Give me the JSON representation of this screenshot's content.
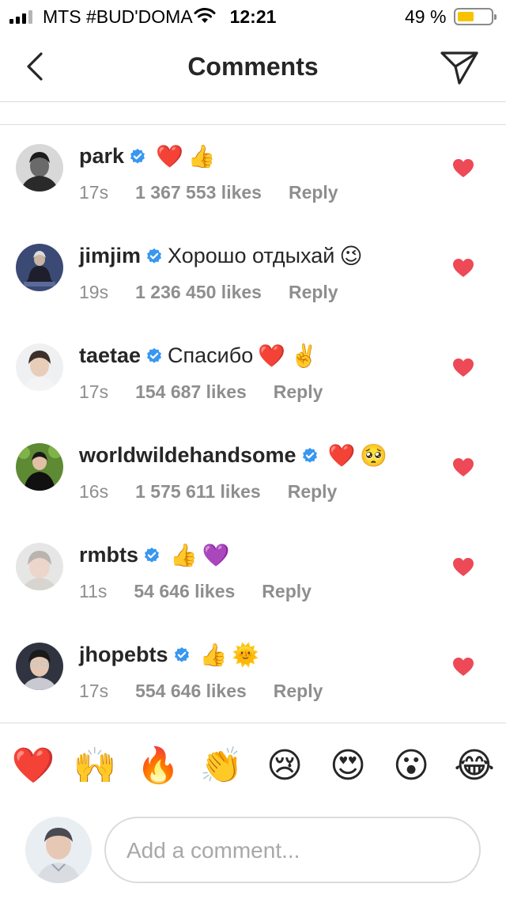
{
  "status_bar": {
    "carrier": "MTS #BUD'DOMA",
    "time": "12:21",
    "battery": "49 %",
    "battery_level": 0.49
  },
  "header": {
    "title": "Comments",
    "back_icon": "chevron-left-icon",
    "send_icon": "paper-plane-icon"
  },
  "comments": [
    {
      "username": "park",
      "text": "",
      "emoji": [
        "❤️",
        "👍"
      ],
      "time": "17s",
      "likes": "1 367 553 likes",
      "reply": "Reply"
    },
    {
      "username": "jimjim",
      "text": "Хорошо отдыхай",
      "emoji": [
        "😉"
      ],
      "time": "19s",
      "likes": "1 236 450 likes",
      "reply": "Reply"
    },
    {
      "username": "taetae",
      "text": "Спасибо",
      "emoji": [
        "❤️",
        "✌️"
      ],
      "time": "17s",
      "likes": "154 687 likes",
      "reply": "Reply"
    },
    {
      "username": "worldwildehandsome",
      "text": "",
      "emoji": [
        "❤️",
        "🥺"
      ],
      "time": "16s",
      "likes": "1 575 611 likes",
      "reply": "Reply"
    },
    {
      "username": "rmbts",
      "text": "",
      "emoji": [
        "👍",
        "💜"
      ],
      "time": "11s",
      "likes": "54 646 likes",
      "reply": "Reply"
    },
    {
      "username": "jhopebts",
      "text": "",
      "emoji": [
        "👍",
        "🌞"
      ],
      "time": "17s",
      "likes": "554 646 likes",
      "reply": "Reply"
    }
  ],
  "reactions": [
    "❤️",
    "🙌",
    "🔥",
    "👏",
    "😢",
    "😍",
    "😮",
    "😂"
  ],
  "input": {
    "placeholder": "Add a comment...",
    "value": ""
  },
  "colors": {
    "verified": "#3897f0",
    "like_heart": "#ed4956",
    "meta_text": "#8e8e8e",
    "divider": "#dbdbdb"
  }
}
